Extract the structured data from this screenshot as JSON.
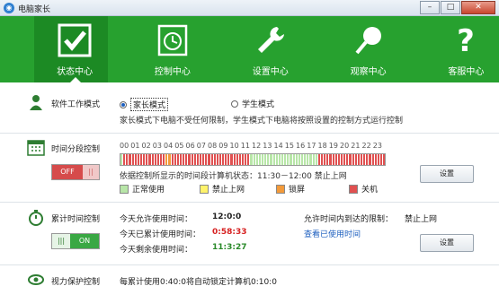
{
  "window": {
    "title": "电脑家长",
    "min": "–",
    "max": "□",
    "close": "✕"
  },
  "toolbar": [
    {
      "label": "状态中心",
      "icon": "checkmark-icon",
      "active": true
    },
    {
      "label": "控制中心",
      "icon": "clock-calendar-icon",
      "active": false
    },
    {
      "label": "设置中心",
      "icon": "wrench-icon",
      "active": false
    },
    {
      "label": "观察中心",
      "icon": "magnifier-icon",
      "active": false
    },
    {
      "label": "客服中心",
      "icon": "question-mark-icon",
      "active": false
    }
  ],
  "mode": {
    "title": "软件工作模式",
    "options": [
      {
        "label": "家长模式",
        "selected": true
      },
      {
        "label": "学生模式",
        "selected": false
      }
    ],
    "description": "家长模式下电脑不受任何限制，学生模式下电脑将按照设置的控制方式运行控制"
  },
  "time_control": {
    "title": "时间分段控制",
    "toggle": "OFF",
    "hours": [
      "00",
      "01",
      "02",
      "03",
      "04",
      "05",
      "06",
      "07",
      "08",
      "09",
      "10",
      "11",
      "12",
      "13",
      "14",
      "15",
      "16",
      "17",
      "18",
      "19",
      "20",
      "21",
      "22",
      "23"
    ],
    "cells": [
      "g",
      "r",
      "r",
      "r",
      "r",
      "r",
      "r",
      "r",
      "r",
      "r",
      "r",
      "r",
      "r",
      "r",
      "r",
      "r",
      "o",
      "o",
      "r",
      "r",
      "r",
      "r",
      "r",
      "r",
      "r",
      "r",
      "r",
      "r",
      "r",
      "r",
      "r",
      "r",
      "r",
      "r",
      "r",
      "r",
      "r",
      "r",
      "r",
      "r",
      "r",
      "r",
      "r",
      "r",
      "r",
      "r",
      "g",
      "g",
      "g",
      "g",
      "g",
      "g",
      "g",
      "g",
      "g",
      "g",
      "g",
      "g",
      "g",
      "g",
      "g",
      "g",
      "g",
      "g",
      "g",
      "g",
      "g",
      "g",
      "g",
      "g",
      "r",
      "r",
      "r",
      "r",
      "r",
      "r",
      "r",
      "r",
      "r",
      "r",
      "r",
      "r",
      "r",
      "r",
      "r",
      "r",
      "r",
      "r",
      "r",
      "r",
      "r",
      "r",
      "r",
      "r"
    ],
    "status": "依据控制所显示的时间段计算机状态：11:30－12:00 禁止上网",
    "legend": [
      {
        "label": "正常使用",
        "color": "#b8e6a8"
      },
      {
        "label": "禁止上网",
        "color": "#fff36b"
      },
      {
        "label": "锁屏",
        "color": "#f39a3a"
      },
      {
        "label": "关机",
        "color": "#e05050"
      }
    ],
    "settings_button": "设置"
  },
  "cumulative": {
    "title": "累计时间控制",
    "toggle": "ON",
    "rows": [
      {
        "label": "今天允许使用时间：",
        "value": "12:0:0",
        "color": "#222"
      },
      {
        "label": "今天已累计使用时间：",
        "value": "0:58:33",
        "color": "#d62020"
      },
      {
        "label": "今天剩余使用时间：",
        "value": "11:3:27",
        "color": "#2a8a2a"
      }
    ],
    "side_label": "允许时间内到达的限制：",
    "side_value": "禁止上网",
    "link": "查看已使用时间",
    "settings_button": "设置"
  },
  "vision": {
    "title": "视力保护控制",
    "text": "每累计使用0:40:0将自动锁定计算机0:10:0"
  },
  "colors": {
    "green_bar": "#27a12f",
    "active_tab": "#1c8a24"
  }
}
